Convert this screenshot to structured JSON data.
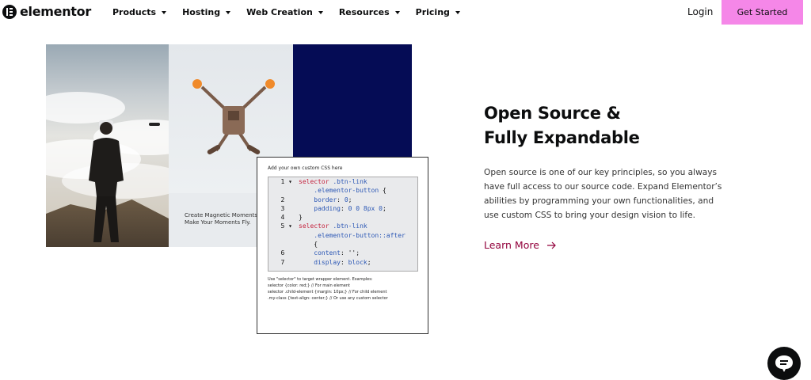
{
  "nav": {
    "logo_text": "elementor",
    "menu": [
      {
        "label": "Products"
      },
      {
        "label": "Hosting"
      },
      {
        "label": "Web Creation"
      },
      {
        "label": "Resources"
      },
      {
        "label": "Pricing"
      }
    ],
    "login_label": "Login",
    "cta_label": "Get Started",
    "cta_color": "#f587e8"
  },
  "collage": {
    "drone_caption_line1": "Create Magnetic Moments",
    "drone_caption_line2": "Make Your Moments Fly.",
    "navy_color": "#050c55",
    "css_editor": {
      "title": "Add your own custom CSS here",
      "lines": [
        {
          "n": "1",
          "fold": true,
          "parts": [
            [
              "sel",
              "selector"
            ],
            [
              "txt",
              " "
            ],
            [
              "cls",
              ".btn-link"
            ]
          ]
        },
        {
          "n": "",
          "fold": false,
          "parts": [
            [
              "txt",
              "    "
            ],
            [
              "cls",
              ".elementor-button"
            ],
            [
              "txt",
              " {"
            ]
          ]
        },
        {
          "n": "2",
          "fold": false,
          "parts": [
            [
              "txt",
              "    "
            ],
            [
              "prop",
              "border"
            ],
            [
              "txt",
              ": "
            ],
            [
              "val",
              "0"
            ],
            [
              "txt",
              ";"
            ]
          ]
        },
        {
          "n": "3",
          "fold": false,
          "parts": [
            [
              "txt",
              "    "
            ],
            [
              "prop",
              "padding"
            ],
            [
              "txt",
              ": "
            ],
            [
              "val",
              "0 0 8px 0"
            ],
            [
              "txt",
              ";"
            ]
          ]
        },
        {
          "n": "4",
          "fold": false,
          "parts": [
            [
              "txt",
              "}"
            ]
          ]
        },
        {
          "n": "5",
          "fold": true,
          "parts": [
            [
              "sel",
              "selector"
            ],
            [
              "txt",
              " "
            ],
            [
              "cls",
              ".btn-link"
            ]
          ]
        },
        {
          "n": "",
          "fold": false,
          "parts": [
            [
              "txt",
              "    "
            ],
            [
              "cls",
              ".elementor-button::after"
            ]
          ]
        },
        {
          "n": "",
          "fold": false,
          "parts": [
            [
              "txt",
              "    {"
            ]
          ]
        },
        {
          "n": "6",
          "fold": false,
          "parts": [
            [
              "txt",
              "    "
            ],
            [
              "prop",
              "content"
            ],
            [
              "txt",
              ": '';"
            ]
          ]
        },
        {
          "n": "7",
          "fold": false,
          "parts": [
            [
              "txt",
              "    "
            ],
            [
              "prop",
              "display"
            ],
            [
              "txt",
              ": "
            ],
            [
              "val",
              "block"
            ],
            [
              "txt",
              ";"
            ]
          ]
        }
      ],
      "notes": [
        "Use \"selector\" to target wrapper element. Examples:",
        "selector {color: red;} // For main element",
        "selector .child-element {margin: 10px;} // For child element",
        ".my-class {text-align: center;} // Or use any custom selector"
      ]
    }
  },
  "content": {
    "heading_line1": "Open Source &",
    "heading_line2": "Fully Expandable",
    "description": "Open source is one of our key principles, so you always have full access to our source code. Expand Elementor’s abilities by programming your own functionalities, and use custom CSS to bring your design vision to life.",
    "learn_more_label": "Learn More",
    "accent_color": "#92003b"
  },
  "chat": {
    "icon": "chat-bubble-icon"
  }
}
